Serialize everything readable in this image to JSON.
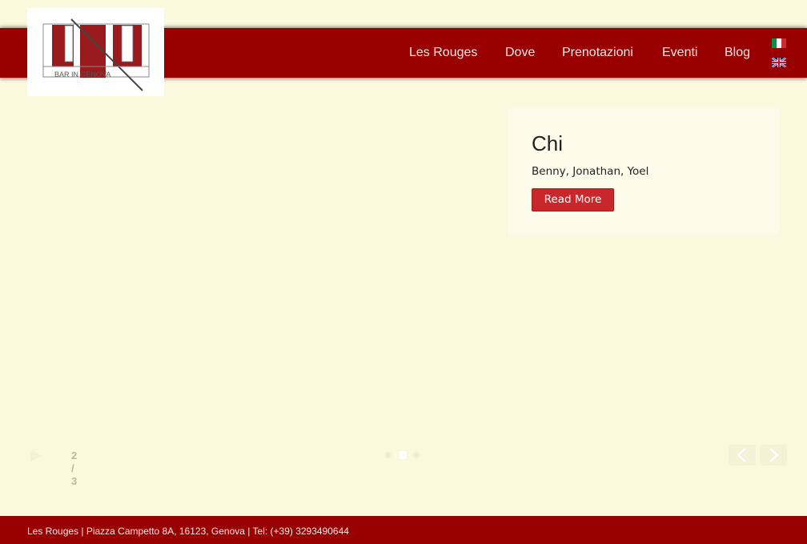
{
  "header": {
    "logo": {
      "alt_text": "BAR IN GENOVA",
      "icon": "les-rouges-logo"
    },
    "nav": [
      {
        "label": "Les Rouges"
      },
      {
        "label": "Dove"
      },
      {
        "label": "Prenotazioni"
      },
      {
        "label": "Eventi"
      },
      {
        "label": "Blog"
      }
    ],
    "languages": [
      {
        "icon": "italian-flag-icon"
      },
      {
        "icon": "uk-flag-icon"
      }
    ]
  },
  "slide": {
    "title": "Chi",
    "text": "Benny, Jonathan, Yoel",
    "button_label": "Read More"
  },
  "slider": {
    "counter": "2 / 3",
    "total_slides": 3,
    "active_slide": 2,
    "play_icon": "play-icon",
    "prev_icon": "chevron-left-icon",
    "next_icon": "chevron-right-icon"
  },
  "footer": {
    "text": "Les Rouges | Piazza Campetto 8A, 16123, Genova | Tel: (+39) 3293490644"
  },
  "colors": {
    "page_background": "#fbf9dd",
    "bar_red": "#990000",
    "button_red": "#c8282a",
    "card_background": "#fcfbea"
  }
}
